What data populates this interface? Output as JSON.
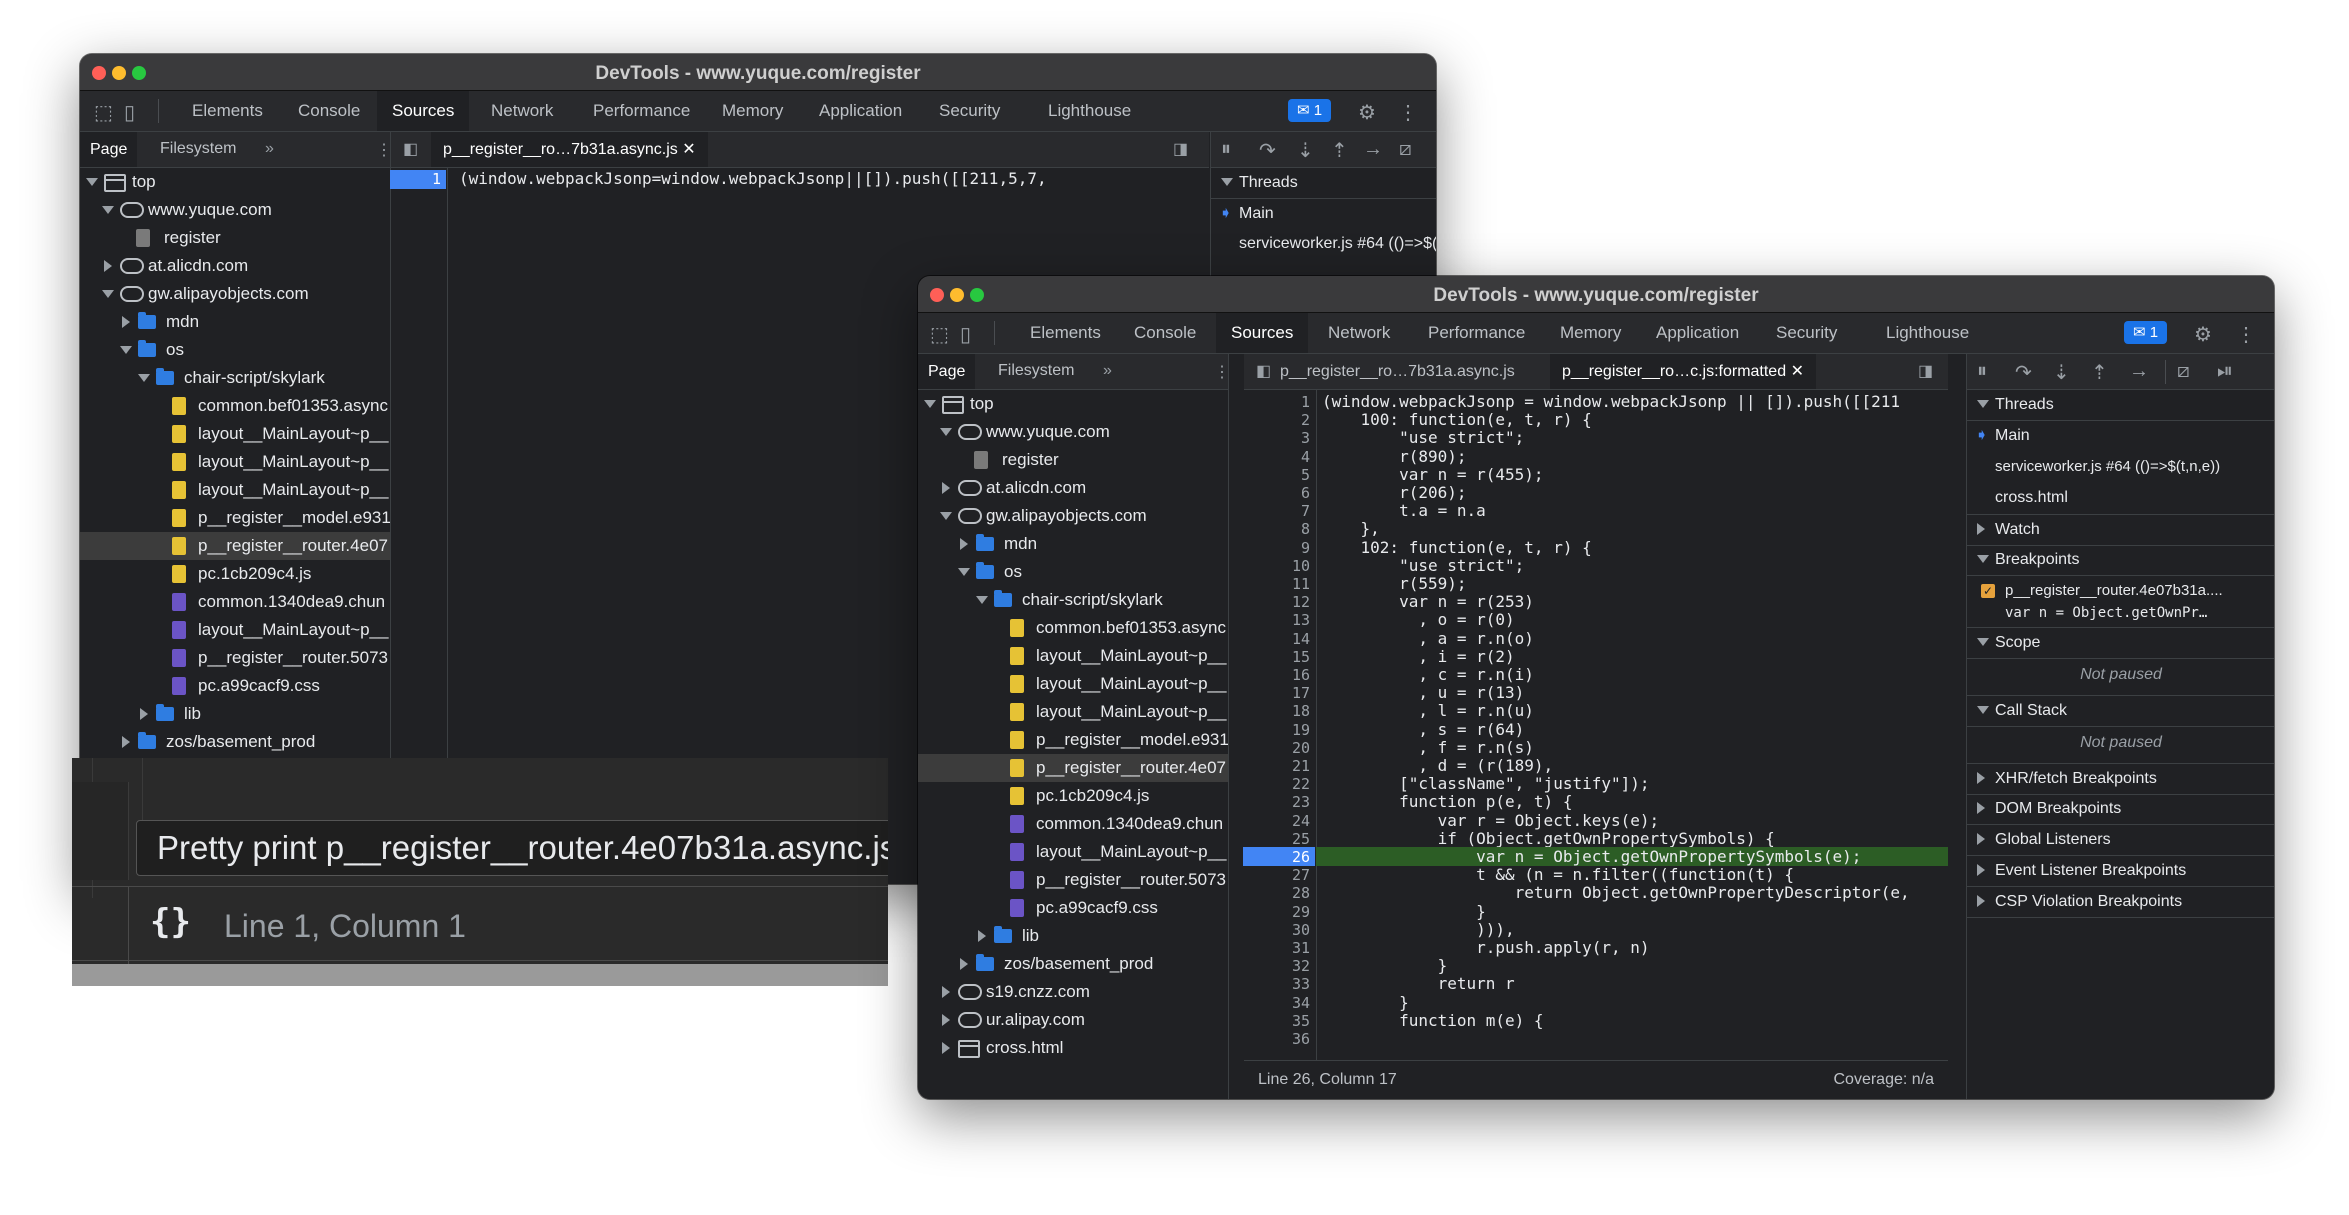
{
  "back_window": {
    "title": "DevTools - www.yuque.com/register",
    "tabs": [
      "Elements",
      "Console",
      "Sources",
      "Network",
      "Performance",
      "Memory",
      "Application",
      "Security",
      "Lighthouse"
    ],
    "active_tab": "Sources",
    "badge": "1",
    "nav_tabs": [
      "Page",
      "Filesystem"
    ],
    "tree": [
      {
        "label": "top"
      },
      {
        "label": "www.yuque.com"
      },
      {
        "label": "register"
      },
      {
        "label": "at.alicdn.com"
      },
      {
        "label": "gw.alipayobjects.com"
      },
      {
        "label": "mdn"
      },
      {
        "label": "os"
      },
      {
        "label": "chair-script/skylark"
      },
      {
        "label": "common.bef01353.async"
      },
      {
        "label": "layout__MainLayout~p__"
      },
      {
        "label": "layout__MainLayout~p__"
      },
      {
        "label": "layout__MainLayout~p__"
      },
      {
        "label": "p__register__model.e931"
      },
      {
        "label": "p__register__router.4e07"
      },
      {
        "label": "pc.1cb209c4.js"
      },
      {
        "label": "common.1340dea9.chun"
      },
      {
        "label": "layout__MainLayout~p__"
      },
      {
        "label": "p__register__router.5073"
      },
      {
        "label": "pc.a99cacf9.css"
      },
      {
        "label": "lib"
      },
      {
        "label": "zos/basement_prod"
      }
    ],
    "file_tab": "p__register__ro…7b31a.async.js",
    "line_number": "1",
    "code_line": "(window.webpackJsonp=window.webpackJsonp||[]).push([[211,5,7,",
    "threads_header": "Threads",
    "thread_main": "Main",
    "thread_sw": "serviceworker.js #64 (()=>$(t,n,e))"
  },
  "zoom_overlay": {
    "tooltip": "Pretty print p__register__router.4e07b31a.async.js",
    "pretty_icon": "{}",
    "position": "Line 1, Column 1"
  },
  "front_window": {
    "title": "DevTools - www.yuque.com/register",
    "tabs": [
      "Elements",
      "Console",
      "Sources",
      "Network",
      "Performance",
      "Memory",
      "Application",
      "Security",
      "Lighthouse"
    ],
    "active_tab": "Sources",
    "badge": "1",
    "nav_tabs": [
      "Page",
      "Filesystem"
    ],
    "tree": [
      {
        "label": "top"
      },
      {
        "label": "www.yuque.com"
      },
      {
        "label": "register"
      },
      {
        "label": "at.alicdn.com"
      },
      {
        "label": "gw.alipayobjects.com"
      },
      {
        "label": "mdn"
      },
      {
        "label": "os"
      },
      {
        "label": "chair-script/skylark"
      },
      {
        "label": "common.bef01353.async"
      },
      {
        "label": "layout__MainLayout~p__"
      },
      {
        "label": "layout__MainLayout~p__"
      },
      {
        "label": "layout__MainLayout~p__"
      },
      {
        "label": "p__register__model.e931"
      },
      {
        "label": "p__register__router.4e07"
      },
      {
        "label": "pc.1cb209c4.js"
      },
      {
        "label": "common.1340dea9.chun"
      },
      {
        "label": "layout__MainLayout~p__"
      },
      {
        "label": "p__register__router.5073"
      },
      {
        "label": "pc.a99cacf9.css"
      },
      {
        "label": "lib"
      },
      {
        "label": "zos/basement_prod"
      },
      {
        "label": "s19.cnzz.com"
      },
      {
        "label": "ur.alipay.com"
      },
      {
        "label": "cross.html"
      }
    ],
    "file_tabs": [
      "p__register__ro…7b31a.async.js",
      "p__register__ro…c.js:formatted"
    ],
    "code_lines": [
      "(window.webpackJsonp = window.webpackJsonp || []).push([[211",
      "    100: function(e, t, r) {",
      "        \"use strict\";",
      "        r(890);",
      "        var n = r(455);",
      "        r(206);",
      "        t.a = n.a",
      "    },",
      "    102: function(e, t, r) {",
      "        \"use strict\";",
      "        r(559);",
      "        var n = r(253)",
      "          , o = r(0)",
      "          , a = r.n(o)",
      "          , i = r(2)",
      "          , c = r.n(i)",
      "          , u = r(13)",
      "          , l = r.n(u)",
      "          , s = r(64)",
      "          , f = r.n(s)",
      "          , d = (r(189),",
      "        [\"className\", \"justify\"]);",
      "        function p(e, t) {",
      "            var r = Object.keys(e);",
      "            if (Object.getOwnPropertySymbols) {",
      "                var n = Object.getOwnPropertySymbols(e);",
      "                t && (n = n.filter((function(t) {",
      "                    return Object.getOwnPropertyDescriptor(e,",
      "                }",
      "                ))),",
      "                r.push.apply(r, n)",
      "            }",
      "            return r",
      "        }",
      "        function m(e) {",
      ""
    ],
    "status_position": "Line 26, Column 17",
    "coverage": "Coverage: n/a",
    "debugger": {
      "threads": "Threads",
      "thread_main": "Main",
      "thread_sw": "serviceworker.js #64 (()=>$(t,n,e))",
      "thread_cross": "cross.html",
      "watch": "Watch",
      "breakpoints": "Breakpoints",
      "bp_file": "p__register__router.4e07b31a....",
      "bp_code": "var n = Object.getOwnPr…",
      "scope": "Scope",
      "not_paused_1": "Not paused",
      "call_stack": "Call Stack",
      "not_paused_2": "Not paused",
      "xhr": "XHR/fetch Breakpoints",
      "dom": "DOM Breakpoints",
      "global": "Global Listeners",
      "event": "Event Listener Breakpoints",
      "csp": "CSP Violation Breakpoints"
    }
  }
}
